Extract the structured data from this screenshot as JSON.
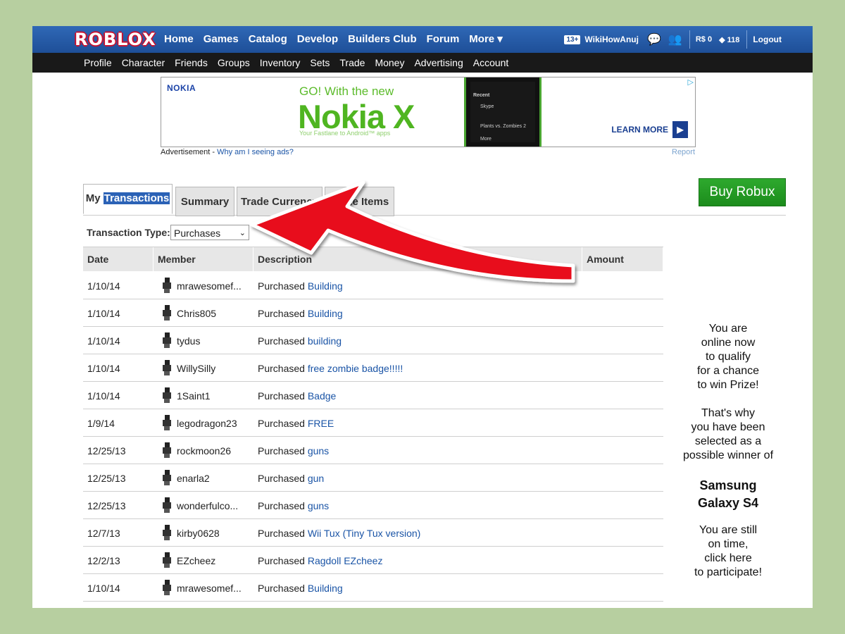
{
  "nav": {
    "logo": "ROBLOX",
    "items": [
      "Home",
      "Games",
      "Catalog",
      "Develop",
      "Builders Club",
      "Forum",
      "More ▾"
    ],
    "age_badge": "13+",
    "username": "WikiHowAnuj",
    "robux_label": "R$",
    "robux": "0",
    "tickets": "118",
    "logout": "Logout"
  },
  "subnav": {
    "items": [
      "Profile",
      "Character",
      "Friends",
      "Groups",
      "Inventory",
      "Sets",
      "Trade",
      "Money",
      "Advertising",
      "Account"
    ]
  },
  "ad": {
    "brand": "NOKIA",
    "headline": "GO! With the new",
    "product": "Nokia X",
    "tagline": "Your Fastlane to Android™ apps",
    "cta": "LEARN MORE",
    "note_prefix": "Advertisement - ",
    "note_link": "Why am I seeing ads?",
    "report": "Report",
    "phone_recent": "Recent",
    "phone_app1": "Skype",
    "phone_app2": "Plants vs. Zombies 2",
    "phone_app3": "More"
  },
  "tabs": {
    "my_prefix": "My ",
    "my_highlight": "Transactions",
    "summary": "Summary",
    "trade_currency": "Trade Currency",
    "trade_items": "Trade Items"
  },
  "buy_robux": "Buy Robux",
  "filter": {
    "label": "Transaction Type:",
    "selected": "Purchases"
  },
  "table": {
    "headers": [
      "Date",
      "Member",
      "Description",
      "Amount"
    ],
    "rows": [
      {
        "date": "1/10/14",
        "member": "mrawesomef...",
        "action": "Purchased",
        "item": "Building"
      },
      {
        "date": "1/10/14",
        "member": "Chris805",
        "action": "Purchased",
        "item": "Building"
      },
      {
        "date": "1/10/14",
        "member": "tydus",
        "action": "Purchased",
        "item": "building"
      },
      {
        "date": "1/10/14",
        "member": "WillySilly",
        "action": "Purchased",
        "item": "free zombie badge!!!!!"
      },
      {
        "date": "1/10/14",
        "member": "1Saint1",
        "action": "Purchased",
        "item": "Badge"
      },
      {
        "date": "1/9/14",
        "member": "legodragon23",
        "action": "Purchased",
        "item": "FREE"
      },
      {
        "date": "12/25/13",
        "member": "rockmoon26",
        "action": "Purchased",
        "item": "guns"
      },
      {
        "date": "12/25/13",
        "member": "enarla2",
        "action": "Purchased",
        "item": "gun"
      },
      {
        "date": "12/25/13",
        "member": "wonderfulco...",
        "action": "Purchased",
        "item": "guns"
      },
      {
        "date": "12/7/13",
        "member": "kirby0628",
        "action": "Purchased",
        "item": "Wii Tux (Tiny Tux version)"
      },
      {
        "date": "12/2/13",
        "member": "EZcheez",
        "action": "Purchased",
        "item": "Ragdoll EZcheez"
      },
      {
        "date": "1/10/14",
        "member": "mrawesomef...",
        "action": "Purchased",
        "item": "Building"
      }
    ]
  },
  "promo": {
    "lines1": [
      "You are",
      "online now",
      "to qualify",
      "for a chance",
      "to win Prize!"
    ],
    "lines2": [
      "That's why",
      "you have been",
      "selected as a",
      "possible winner of"
    ],
    "prize1": "Samsung",
    "prize2": "Galaxy S4",
    "lines3": [
      "You are still",
      "on time,",
      "click here",
      "to participate!"
    ]
  },
  "colors": {
    "nav_blue": "#1e4f98",
    "link_blue": "#1a54a6",
    "buy_green": "#2ea92e",
    "arrow_red": "#e8101c",
    "frame_bg": "#b7cfa0"
  }
}
